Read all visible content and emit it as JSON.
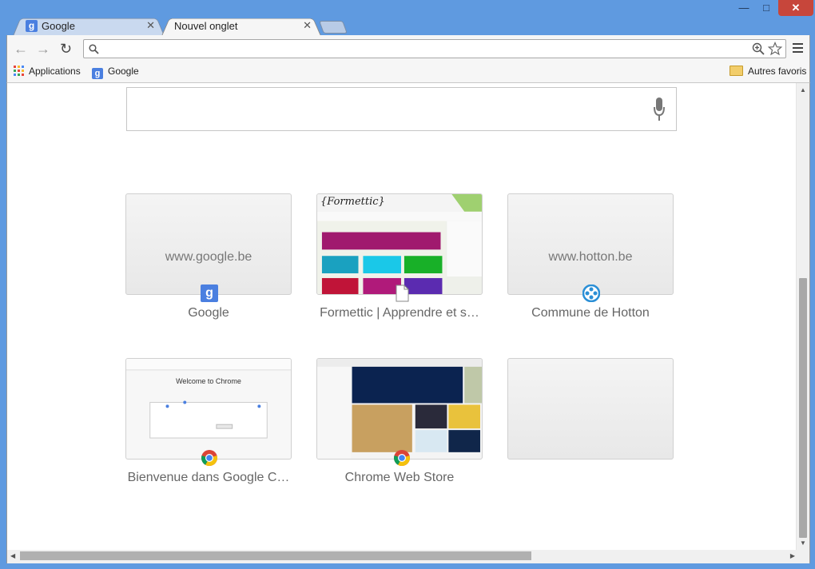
{
  "window": {
    "minimize": "—",
    "maximize": "□",
    "close": "✕"
  },
  "tabs": [
    {
      "label": "Google",
      "active": false,
      "close": "✕"
    },
    {
      "label": "Nouvel onglet",
      "active": true,
      "close": "✕"
    }
  ],
  "toolbar": {
    "back": "←",
    "forward": "→",
    "reload": "↻",
    "address_value": "",
    "address_placeholder": ""
  },
  "bookmarks": {
    "apps_label": "Applications",
    "google_label": "Google",
    "other_label": "Autres favoris"
  },
  "search": {
    "placeholder": ""
  },
  "tiles": [
    {
      "title": "Google",
      "url_text": "www.google.be",
      "favicon": "google-icon"
    },
    {
      "title": "Formettic | Apprendre et s…",
      "url_text": "",
      "favicon": "page-icon",
      "thumb_heading": "{Formettic}"
    },
    {
      "title": "Commune de Hotton",
      "url_text": "www.hotton.be",
      "favicon": "hotton-icon"
    },
    {
      "title": "Bienvenue dans Google C…",
      "url_text": "",
      "favicon": "chrome-icon",
      "thumb_heading": "Welcome to Chrome"
    },
    {
      "title": "Chrome Web Store",
      "url_text": "",
      "favicon": "chrome-icon"
    },
    {
      "title": "",
      "url_text": "",
      "favicon": ""
    }
  ],
  "colors": {
    "frame": "#5f9ae0",
    "close_button": "#c7463b",
    "google_blue": "#4a7fe0",
    "hotton_blue": "#2b8fd6"
  }
}
